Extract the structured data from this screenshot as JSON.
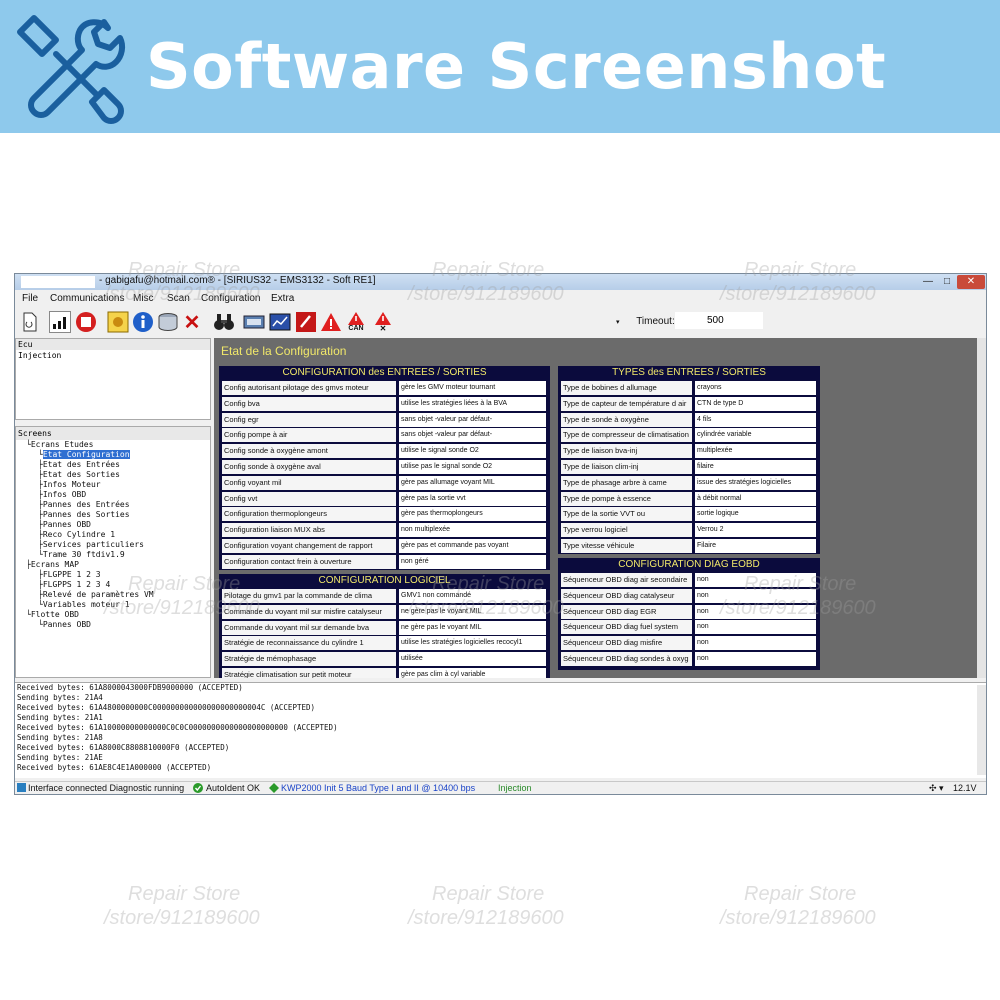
{
  "banner": {
    "title": "Software Screenshot",
    "icon": "wrench-screwdriver-icon"
  },
  "window": {
    "title": "- gabigafu@hotmail.com® - [SIRIUS32 - EMS3132 - Soft RE1]",
    "controls": {
      "minimize": "—",
      "maximize": "□",
      "close": "✕"
    }
  },
  "menu": {
    "file": "File",
    "communications": "Communications",
    "misc": "Misc",
    "scan": "Scan",
    "configuration": "Configuration",
    "extra": "Extra"
  },
  "toolbar": {
    "timeout_label": "Timeout:",
    "timeout_value": "500",
    "can_label": "CAN"
  },
  "ecu": {
    "header": "Ecu",
    "item": "Injection"
  },
  "screens": {
    "header": "Screens",
    "nodes": [
      "Ecrans Etudes",
      "Etat Configuration",
      "Etat des Entrées",
      "Etat des Sorties",
      "Infos Moteur",
      "Infos OBD",
      "Pannes des Entrées",
      "Pannes des Sorties",
      "Pannes OBD",
      "Reco Cylindre 1",
      "Services particuliers",
      "Trame 30 ftdiv1.9",
      "Ecrans MAP",
      "FLGPPE 1 2 3",
      "FLGPPS 1 2 3 4",
      "Relevé de paramètres VM",
      "Variables moteur 1",
      "Flotte OBD",
      "Pannes OBD"
    ]
  },
  "main": {
    "title": "Etat de la Configuration",
    "io_config": {
      "title": "CONFIGURATION des ENTREES / SORTIES",
      "rows": [
        [
          "Config autorisant pilotage des gmvs moteur",
          "gère les GMV moteur tournant"
        ],
        [
          "Config bva",
          "utilise les stratégies liées à la BVA"
        ],
        [
          "Config egr",
          "sans objet -valeur par défaut-"
        ],
        [
          "Config pompe à air",
          "sans objet -valeur par défaut-"
        ],
        [
          "Config sonde à oxygène amont",
          "utilise le signal sonde O2"
        ],
        [
          "Config sonde à oxygène aval",
          "utilise pas le signal sonde O2"
        ],
        [
          "Config voyant mil",
          "gère pas allumage voyant MIL"
        ],
        [
          "Config vvt",
          "gère pas la sortie vvt"
        ],
        [
          "Configuration thermoplongeurs",
          "gère pas thermoplongeurs"
        ],
        [
          "Configuration liaison MUX abs",
          "non multiplexée"
        ],
        [
          "Configuration voyant changement de rapport",
          "gère pas et commande pas voyant"
        ],
        [
          "Configuration contact frein à ouverture",
          "non géré"
        ]
      ]
    },
    "sw_config": {
      "title": "CONFIGURATION LOGICIEL",
      "rows": [
        [
          "Pilotage du gmv1 par la commande de clima",
          "GMV1 non commandé"
        ],
        [
          "Commande du voyant mil sur misfire catalyseur",
          "ne gère pas le voyant MIL"
        ],
        [
          "Commande du voyant mil sur demande bva",
          "ne gère pas le voyant MIL"
        ],
        [
          "Stratégie de reconnaissance du cylindre 1",
          "utilise les stratégies logicielles recocyl1"
        ],
        [
          "Stratégie de mémophasage",
          "utilisée"
        ],
        [
          "Stratégie climatisation sur petit moteur",
          "gère pas clim à cyl variable"
        ]
      ]
    },
    "io_types": {
      "title": "TYPES des ENTREES / SORTIES",
      "rows": [
        [
          "Type de bobines d allumage",
          "crayons"
        ],
        [
          "Type de capteur de température d air",
          "CTN de type D"
        ],
        [
          "Type de sonde à oxygène",
          "4 fils"
        ],
        [
          "Type de compresseur de climatisation",
          "cylindrée variable"
        ],
        [
          "Type de liaison bva-inj",
          "multiplexée"
        ],
        [
          "Type de liaison clim-inj",
          "filaire"
        ],
        [
          "Type de phasage arbre à came",
          "issue des stratégies logicielles"
        ],
        [
          "Type de pompe à essence",
          "à débit normal"
        ],
        [
          "Type de la sortie VVT ou",
          "sortie logique"
        ],
        [
          "Type verrou logiciel",
          "Verrou 2"
        ],
        [
          "Type vitesse véhicule",
          "Filaire"
        ]
      ]
    },
    "eobd_config": {
      "title": "CONFIGURATION DIAG EOBD",
      "rows": [
        [
          "Séquenceur OBD diag air secondaire",
          "non"
        ],
        [
          "Séquenceur OBD diag catalyseur",
          "non"
        ],
        [
          "Séquenceur OBD diag EGR",
          "non"
        ],
        [
          "Séquenceur OBD diag fuel system",
          "non"
        ],
        [
          "Séquenceur OBD diag misfire",
          "non"
        ],
        [
          "Séquenceur OBD diag sondes à oxyg",
          "non"
        ]
      ]
    }
  },
  "log": [
    "Received bytes: 61A8000043000FDB9000000 (ACCEPTED)",
    "Sending bytes: 21A4",
    "Received bytes: 61A4800000000C000000000000000000000004C (ACCEPTED)",
    "Sending bytes: 21A1",
    "Received bytes: 61A10000000000000C0C0C0000000000000000000000 (ACCEPTED)",
    "Sending bytes: 21A8",
    "Received bytes: 61A8000C8808810000F0 (ACCEPTED)",
    "Sending bytes: 21AE",
    "Received bytes: 61AE8C4E1A000000 (ACCEPTED)"
  ],
  "status": {
    "interface": "Interface connected Diagnostic running",
    "autoident": "AutoIdent OK",
    "protocol": "KWP2000 Init 5 Baud Type I and II @ 10400 bps",
    "ecu": "Injection",
    "voltage": "12.1V"
  },
  "watermark": {
    "line1": "Repair Store",
    "line2": "/store/912189600"
  },
  "colors": {
    "banner": "#8ec9ec",
    "panel_bg": "#6b6b6b",
    "section_bg": "#0b0b3d",
    "section_title": "#f1e86a",
    "selection": "#2f6fd1"
  }
}
